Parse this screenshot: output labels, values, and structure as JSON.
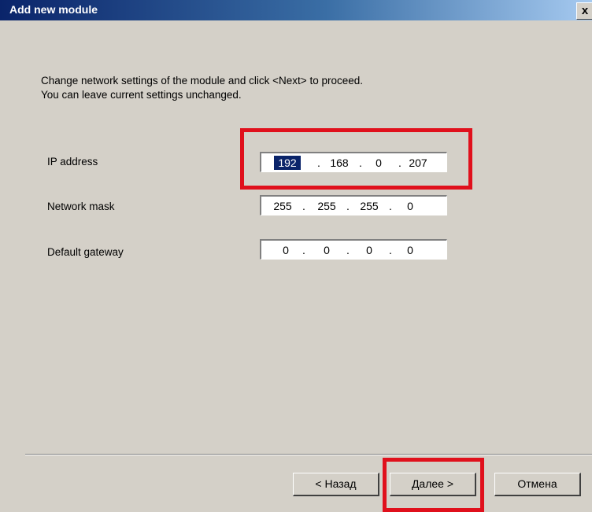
{
  "window": {
    "title": "Add new module",
    "close_glyph": "x"
  },
  "instructions": {
    "line1": "Change network settings of the module and click <Next> to proceed.",
    "line2": "You can leave current settings unchanged."
  },
  "fields": {
    "ip": {
      "label": "IP address",
      "octets": [
        "192",
        "168",
        "0",
        "207"
      ],
      "selected_octet": "192"
    },
    "mask": {
      "label": "Network mask",
      "octets": [
        "255",
        "255",
        "255",
        "0"
      ]
    },
    "gateway": {
      "label": "Default gateway",
      "octets": [
        "0",
        "0",
        "0",
        "0"
      ]
    }
  },
  "separator_dot": ".",
  "buttons": {
    "back": "< Назад",
    "next": "Далее >",
    "cancel": "Отмена"
  },
  "colors": {
    "highlight": "#e0101c",
    "title_bar": "#0a246a",
    "dialog_bg": "#d4d0c8",
    "selection": "#0a246a"
  }
}
